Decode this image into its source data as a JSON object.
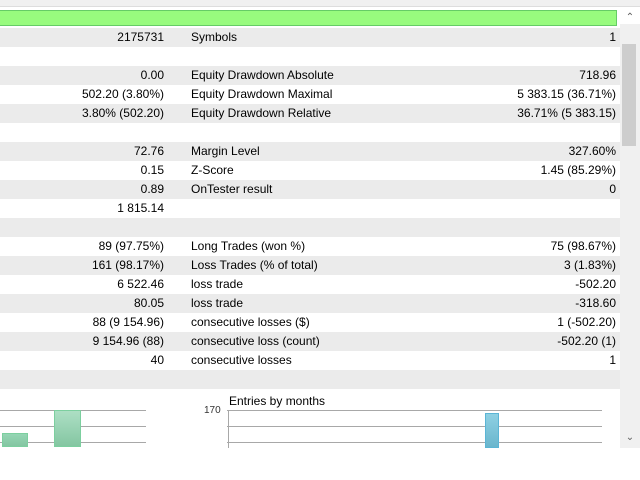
{
  "rows": [
    {
      "v1": "2175731",
      "l2": "Symbols",
      "v2": "1"
    },
    {
      "v1": "",
      "l2": "",
      "v2": ""
    },
    {
      "v1": "0.00",
      "l2": "Equity Drawdown Absolute",
      "v2": "718.96"
    },
    {
      "v1": "502.20 (3.80%)",
      "l2": "Equity Drawdown Maximal",
      "v2": "5 383.15 (36.71%)"
    },
    {
      "v1": "3.80% (502.20)",
      "l2": "Equity Drawdown Relative",
      "v2": "36.71% (5 383.15)"
    },
    {
      "v1": "",
      "l2": "",
      "v2": ""
    },
    {
      "v1": "72.76",
      "l2": "Margin Level",
      "v2": "327.60%"
    },
    {
      "v1": "0.15",
      "l2": "Z-Score",
      "v2": "1.45 (85.29%)"
    },
    {
      "v1": "0.89",
      "l2": "OnTester result",
      "v2": "0"
    },
    {
      "v1": "1 815.14",
      "l2": "",
      "v2": ""
    },
    {
      "v1": "",
      "l2": "",
      "v2": ""
    },
    {
      "v1": "89 (97.75%)",
      "l2": "Long Trades (won %)",
      "v2": "75 (98.67%)"
    },
    {
      "v1": "161 (98.17%)",
      "l2": "Loss Trades (% of total)",
      "v2": "3 (1.83%)"
    },
    {
      "v1": "6 522.46",
      "l2": "loss trade",
      "v2": "-502.20"
    },
    {
      "v1": "80.05",
      "l2": "loss trade",
      "v2": "-318.60"
    },
    {
      "v1": "88 (9 154.96)",
      "l2": "consecutive losses ($)",
      "v2": "1 (-502.20)"
    },
    {
      "v1": "9 154.96 (88)",
      "l2": "consecutive loss (count)",
      "v2": "-502.20 (1)"
    },
    {
      "v1": "40",
      "l2": "consecutive losses",
      "v2": "1"
    },
    {
      "v1": "",
      "l2": "",
      "v2": ""
    }
  ],
  "charts": {
    "months_title": "Entries by months",
    "months_ymax": "170"
  },
  "colors": {
    "green": "#98fb7e",
    "bar_green": "#8fd0ac",
    "bar_blue": "#7cc4da"
  }
}
